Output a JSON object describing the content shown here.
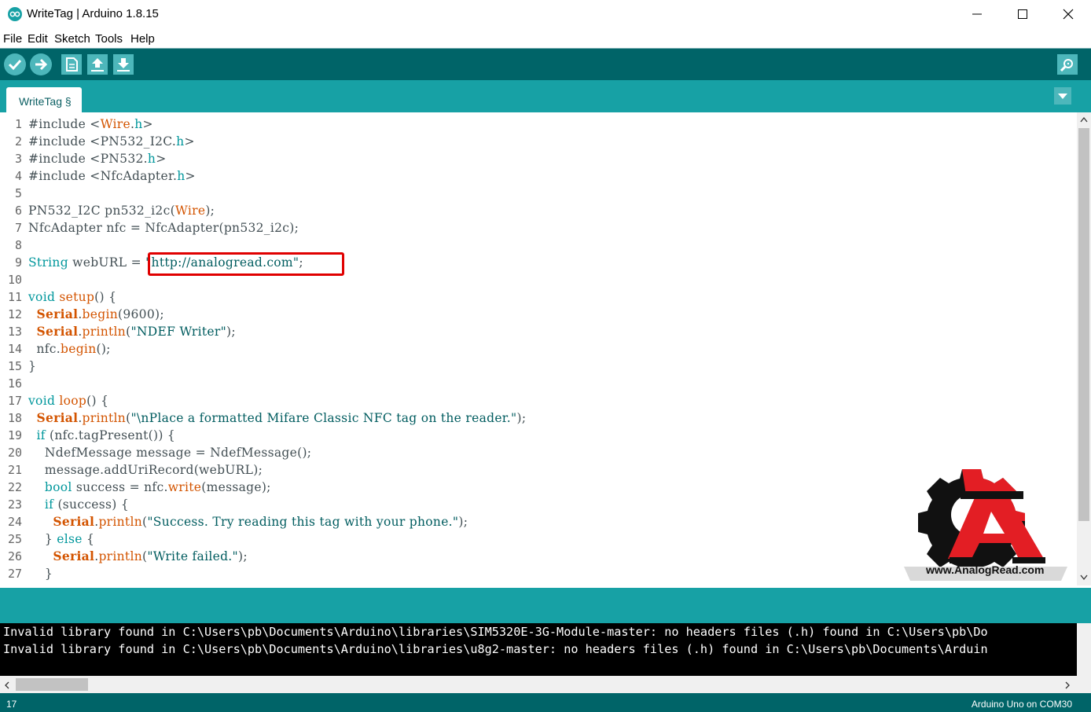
{
  "window": {
    "title": "WriteTag | Arduino 1.8.15",
    "controls": [
      "minimize-icon",
      "maximize-icon",
      "close-icon"
    ]
  },
  "menu": [
    "File",
    "Edit",
    "Sketch",
    "Tools",
    "Help"
  ],
  "toolbar": {
    "buttons": [
      "verify-icon",
      "upload-icon",
      "new-icon",
      "open-icon",
      "save-icon"
    ],
    "right_button": "serial-monitor-icon"
  },
  "tabs": [
    {
      "label": "WriteTag §"
    }
  ],
  "editor": {
    "line_numbers": [
      "1",
      "2",
      "3",
      "4",
      "5",
      "6",
      "7",
      "8",
      "9",
      "10",
      "11",
      "12",
      "13",
      "14",
      "15",
      "16",
      "17",
      "18",
      "19",
      "20",
      "21",
      "22",
      "23",
      "24",
      "25",
      "26",
      "27"
    ],
    "lines": [
      "#include <Wire.h>",
      "#include <PN532_I2C.h>",
      "#include <PN532.h>",
      "#include <NfcAdapter.h>",
      "",
      "PN532_I2C pn532_i2c(Wire);",
      "NfcAdapter nfc = NfcAdapter(pn532_i2c);",
      "",
      "String webURL = \"http://analogread.com\";",
      "",
      "void setup() {",
      "  Serial.begin(9600);",
      "  Serial.println(\"NDEF Writer\");",
      "  nfc.begin();",
      "}",
      "",
      "void loop() {",
      "  Serial.println(\"\\nPlace a formatted Mifare Classic NFC tag on the reader.\");",
      "  if (nfc.tagPresent()) {",
      "    NdefMessage message = NdefMessage();",
      "    message.addUriRecord(webURL);",
      "    bool success = nfc.write(message);",
      "    if (success) {",
      "      Serial.println(\"Success. Try reading this tag with your phone.\");",
      "    } else {",
      "      Serial.println(\"Write failed.\");",
      "    }"
    ],
    "highlighted_text": "\"http://analogread.com\";"
  },
  "watermark": {
    "text": "www.AnalogRead.com"
  },
  "console": {
    "lines": [
      "Invalid library found in C:\\Users\\pb\\Documents\\Arduino\\libraries\\SIM5320E-3G-Module-master: no headers files (.h) found in C:\\Users\\pb\\Do",
      "Invalid library found in C:\\Users\\pb\\Documents\\Arduino\\libraries\\u8g2-master: no headers files (.h) found in C:\\Users\\pb\\Documents\\Arduin"
    ]
  },
  "status": {
    "line": "17",
    "board": "Arduino Uno on COM30"
  },
  "colors": {
    "toolbar": "#006468",
    "tabstrip": "#17a1a5",
    "keyword": "#00979c",
    "function": "#d35400",
    "highlight_border": "#e00000"
  }
}
